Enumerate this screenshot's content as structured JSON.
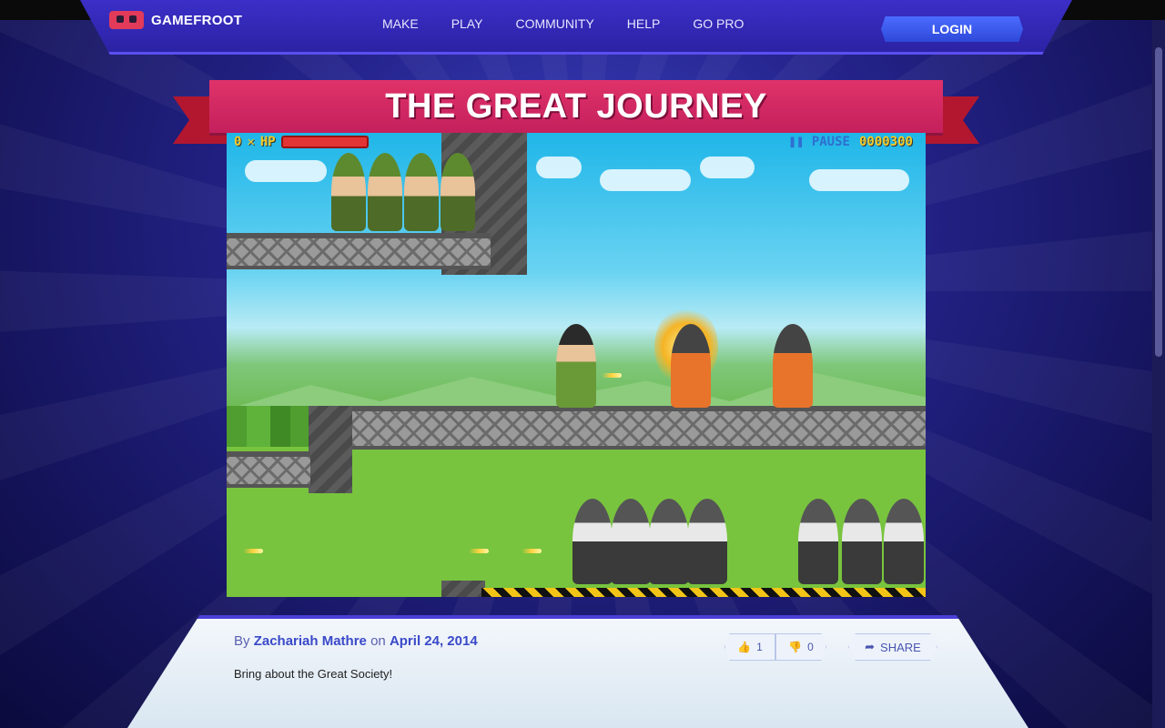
{
  "brand": {
    "name": "GAMEFROOT"
  },
  "nav": {
    "items": [
      "MAKE",
      "PLAY",
      "COMMUNITY",
      "HELP",
      "GO PRO"
    ],
    "login": "LOGIN"
  },
  "game": {
    "title": "THE GREAT JOURNEY",
    "hud": {
      "lives": "0",
      "hp_label": "HP",
      "hp_level": 1.0,
      "pause_label": "PAUSE",
      "score": "0000300"
    }
  },
  "post": {
    "by": "By",
    "author": "Zachariah Mathre",
    "on": "on",
    "date": "April 24, 2014",
    "description": "Bring about the Great Society!",
    "likes": "1",
    "dislikes": "0",
    "share": "SHARE"
  },
  "colors": {
    "accent": "#2b22a4",
    "ribbon": "#d42a64",
    "login": "#3a5cf0"
  }
}
